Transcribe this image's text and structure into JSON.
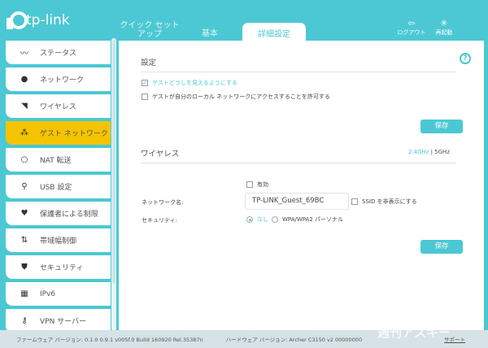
{
  "brand": "tp-link",
  "tabs": [
    {
      "label": "クイック セットアップ"
    },
    {
      "label": "基本"
    },
    {
      "label": "詳細設定"
    }
  ],
  "tools": {
    "logout": "ログアウト",
    "reboot": "再起動"
  },
  "sidebar": {
    "items": [
      {
        "label": "ステータス",
        "icon": "pulse-icon"
      },
      {
        "label": "ネットワーク",
        "icon": "globe-icon"
      },
      {
        "label": "ワイヤレス",
        "icon": "wifi-icon"
      },
      {
        "label": "ゲスト ネットワーク",
        "icon": "guests-icon"
      },
      {
        "label": "NAT 転送",
        "icon": "nat-icon"
      },
      {
        "label": "USB 設定",
        "icon": "usb-icon"
      },
      {
        "label": "保護者による制限",
        "icon": "parental-icon"
      },
      {
        "label": "帯域幅制御",
        "icon": "bandwidth-icon"
      },
      {
        "label": "セキュリティ",
        "icon": "shield-icon"
      },
      {
        "label": "IPv6",
        "icon": "ipv6-icon"
      },
      {
        "label": "VPN サーバー",
        "icon": "vpn-icon"
      }
    ]
  },
  "settings": {
    "title": "設定",
    "help": "?",
    "opt1": "ゲストどうしを見えるようにする",
    "opt2": "ゲストが自分のローカル ネットワークにアクセスすることを許可する",
    "save": "保存"
  },
  "wireless": {
    "title": "ワイヤレス",
    "band_24": "2.4GHz",
    "sep": "|",
    "band_5": "5GHz",
    "enable": "有効",
    "network_name_label": "ネットワーク名:",
    "network_name": "TP-LINK_Guest_69BC",
    "hide_ssid": "SSID を非表示にする",
    "security_label": "セキュリティ:",
    "sec_none": "なし",
    "sec_wpa": "WPA/WPA2 パーソナル",
    "save": "保存"
  },
  "footer": {
    "firmware": "ファームウェア バージョン: 0.1.0 0.9.1 v005f.0 Build 160920 Rel.35387n",
    "hardware": "ハードウェア バージョン: Archer C3150 v2 00000000",
    "support": "サポート"
  },
  "watermark": "週刊アスキー",
  "colors": {
    "accent": "#4bc8d3",
    "active": "#f5c400"
  }
}
